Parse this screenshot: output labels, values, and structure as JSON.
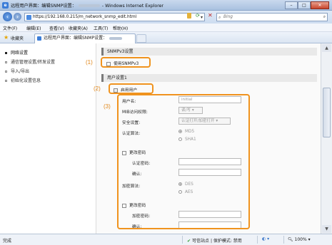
{
  "window": {
    "title_prefix": "远程用户界面：编辑SNMP设置：",
    "title_suffix": "- Windows Internet Explorer",
    "minimize": "–",
    "maximize": "□",
    "close": "✕"
  },
  "address": {
    "url": "https://192.168.0.215/m_network_snmp_edit.html",
    "search_placeholder": "Bing"
  },
  "menu": [
    "文件(F)",
    "编辑(E)",
    "查看(V)",
    "收藏夹(A)",
    "工具(T)",
    "帮助(H)"
  ],
  "favorites": {
    "label": "收藏夹",
    "tab_title": "远程用户界面：编辑SNMP设置："
  },
  "sidebar": {
    "items": [
      {
        "label": "网络设置",
        "active": true
      },
      {
        "label": "通信管理设置/转发设置",
        "active": false
      },
      {
        "label": "导入/导出",
        "active": false
      },
      {
        "label": "初始化设置信息",
        "active": false
      }
    ]
  },
  "snmpv3": {
    "section_title": "SNMPv3设置",
    "use_label": "使用SNMPv3"
  },
  "user": {
    "section_title": "用户设置1",
    "enable_label": "启用用户",
    "username_label": "用户名:",
    "username_value": "initial",
    "mib_label": "MIB访问权限:",
    "mib_value": "读/写",
    "security_label": "安全设置:",
    "security_value": "认证打开/加密打开",
    "auth_algo_label": "认证算法:",
    "auth_options": [
      "MD5",
      "SHA1"
    ],
    "change_pw_label": "更改密码",
    "auth_pw_label": "认证密码:",
    "confirm_label": "确认:",
    "enc_algo_label": "加密算法:",
    "enc_options": [
      "DES",
      "AES"
    ],
    "change_pw_label2": "更改密码",
    "enc_pw_label": "加密密码:",
    "confirm_label2": "确认:"
  },
  "callouts": [
    "(1)",
    "(2)",
    "(3)"
  ],
  "status": {
    "left": "完成",
    "zone": "可信站点 | 保护模式: 禁用",
    "zoom": "100%"
  },
  "colors": {
    "callout": "#f0931e",
    "titlebar": "#b9cde8"
  }
}
